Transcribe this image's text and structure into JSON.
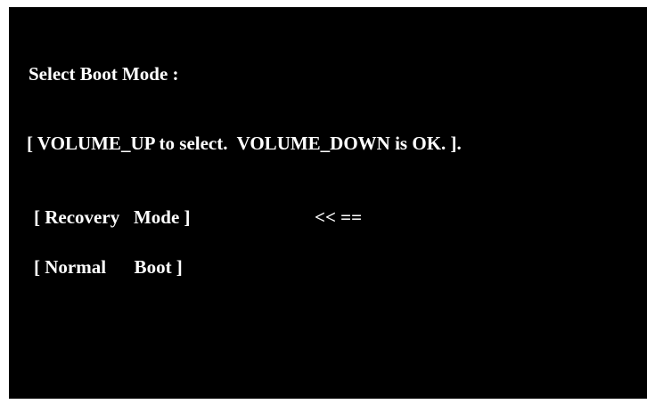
{
  "boot_menu": {
    "title": "Select Boot Mode :",
    "instructions": "[ VOLUME_UP to select.  VOLUME_DOWN is OK. ].",
    "options": [
      {
        "label": "[ Recovery   Mode ]"
      },
      {
        "label": "[ Normal      Boot ]"
      }
    ],
    "selection_indicator": "<< ==",
    "selected_option": "[ Recovery   Mode ]"
  },
  "colors": {
    "background": "#000000",
    "text": "#ffffff",
    "frame": "#ffffff"
  }
}
